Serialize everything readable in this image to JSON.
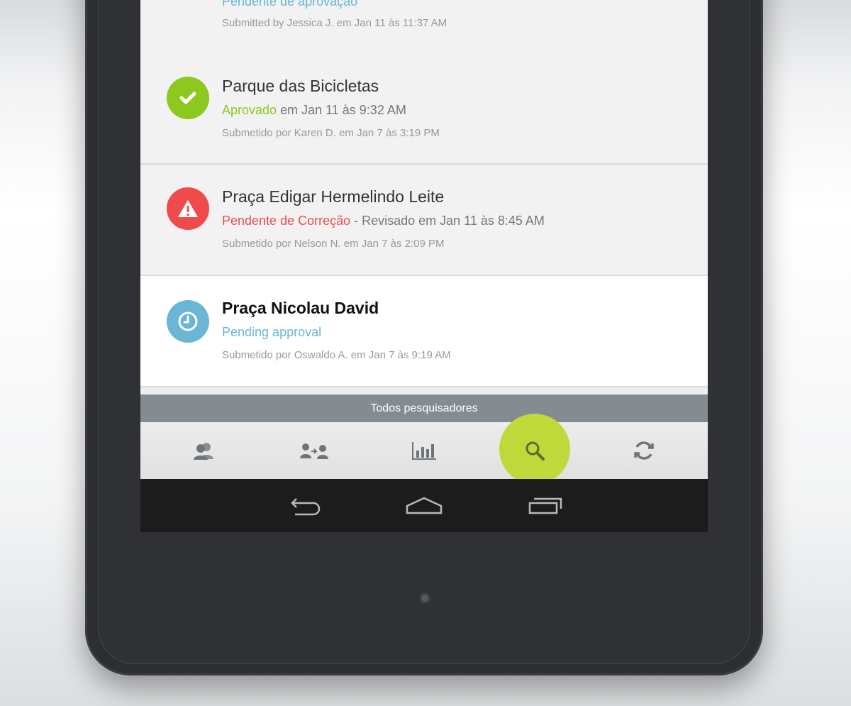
{
  "list": {
    "items": [
      {
        "title": "",
        "status_label": "Pendente de aprovação",
        "status_rest": "",
        "submitted": "Submitted by Jessica J. em Jan 11 às 11:37 AM",
        "status_icon": "clock-icon",
        "status_color": "#6bb6d4"
      },
      {
        "title": "Parque das Bicicletas",
        "status_label": "Aprovado",
        "status_rest": " em Jan 11 às 9:32 AM",
        "submitted": "Submetido por Karen D. em Jan 7 às 3:19 PM",
        "status_icon": "checkmark-icon",
        "status_color": "#8cc81e"
      },
      {
        "title": "Praça Edigar Hermelindo Leite",
        "status_label": "Pendente de Correção",
        "status_rest": " - Revisado em Jan 11 às 8:45 AM",
        "submitted": "Submetido por Nelson N. em Jan 7 às 2:09 PM",
        "status_icon": "warning-icon",
        "status_color": "#f04a4a"
      },
      {
        "title": "Praça Nicolau David",
        "status_label": "Pending approval",
        "status_rest": "",
        "submitted": "Submetido por Oswaldo A. em Jan 7 às 9:19 AM",
        "status_icon": "clock-icon",
        "status_color": "#6bb6d4"
      }
    ]
  },
  "filter": {
    "label": "Todos pesquisadores"
  },
  "tabs": [
    {
      "icon": "users-icon"
    },
    {
      "icon": "user-transfer-icon"
    },
    {
      "icon": "bar-chart-icon"
    },
    {
      "icon": "search-icon",
      "active": true,
      "accent": "#bfd93b"
    },
    {
      "icon": "sync-icon"
    }
  ],
  "system_nav": [
    {
      "icon": "back-icon"
    },
    {
      "icon": "home-icon"
    },
    {
      "icon": "recent-apps-icon"
    }
  ]
}
